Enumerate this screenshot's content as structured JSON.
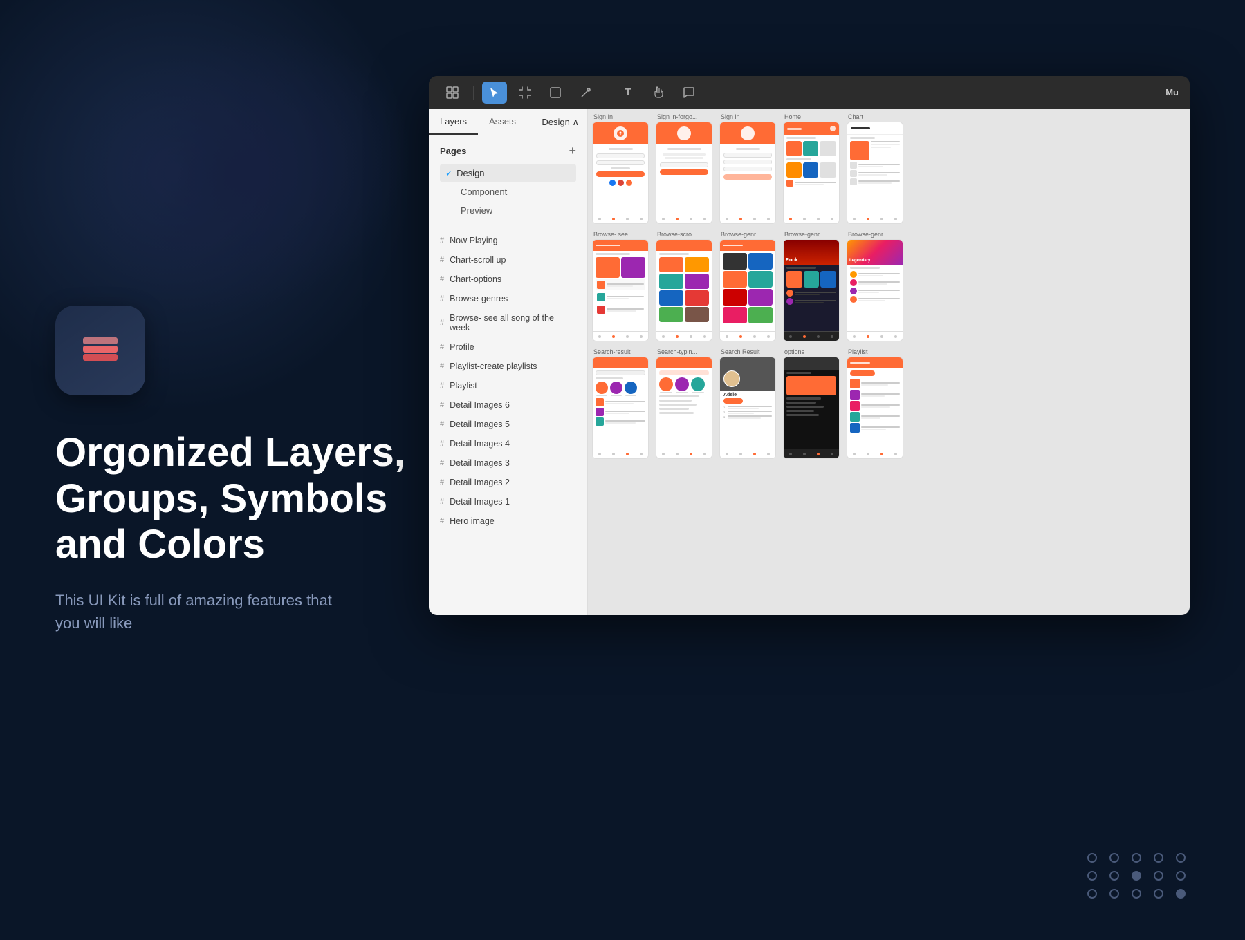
{
  "background": {
    "color": "#0a1628"
  },
  "left_panel": {
    "app_icon_alt": "Layers App Icon",
    "headline": "Orgonized Layers, Groups, Symbols and Colors",
    "subtext": "This UI Kit is full of amazing features that you will like"
  },
  "design_tool": {
    "title": "Mu",
    "toolbar": {
      "tools": [
        {
          "name": "grid-tool",
          "icon": "⊞",
          "active": false
        },
        {
          "name": "select-tool",
          "icon": "▶",
          "active": true
        },
        {
          "name": "frame-tool",
          "icon": "⊡",
          "active": false
        },
        {
          "name": "shape-tool",
          "icon": "□",
          "active": false
        },
        {
          "name": "pen-tool",
          "icon": "✒",
          "active": false
        },
        {
          "name": "text-tool",
          "icon": "T",
          "active": false
        },
        {
          "name": "hand-tool",
          "icon": "✋",
          "active": false
        },
        {
          "name": "comment-tool",
          "icon": "💬",
          "active": false
        }
      ]
    },
    "sidebar": {
      "tabs": [
        "Layers",
        "Assets"
      ],
      "active_tab": "Layers",
      "design_btn": "Design ∧",
      "pages_section": {
        "title": "Pages",
        "pages": [
          {
            "name": "Design",
            "active": true,
            "checked": true
          },
          {
            "name": "Component",
            "active": false
          },
          {
            "name": "Preview",
            "active": false
          }
        ]
      },
      "layers": [
        "Now Playing",
        "Chart-scroll up",
        "Chart-options",
        "Browse-genres",
        "Browse- see all song of the week",
        "Profile",
        "Playlist-create playlists",
        "Playlist",
        "Detail Images 6",
        "Detail Images 5",
        "Detail Images 4",
        "Detail Images 3",
        "Detail Images 2",
        "Detail Images 1",
        "Hero image"
      ]
    },
    "canvas": {
      "rows": [
        {
          "screens": [
            {
              "label": "Sign In",
              "type": "signin"
            },
            {
              "label": "Sign in-forgo...",
              "type": "forgot"
            },
            {
              "label": "Sign in",
              "type": "signup"
            },
            {
              "label": "Home",
              "type": "home"
            },
            {
              "label": "Chart",
              "type": "chart"
            }
          ]
        },
        {
          "screens": [
            {
              "label": "Browse- see...",
              "type": "browse-week"
            },
            {
              "label": "Browse-scro...",
              "type": "browse-scroll"
            },
            {
              "label": "Browse-genr...",
              "type": "browse-genres"
            },
            {
              "label": "Browse-genr...",
              "type": "browse-rock"
            },
            {
              "label": "Browse-genr...",
              "type": "browse-legendary"
            }
          ]
        },
        {
          "screens": [
            {
              "label": "Search-result",
              "type": "search-result"
            },
            {
              "label": "Search-typin...",
              "type": "search-typing"
            },
            {
              "label": "Search Result",
              "type": "search-result2"
            },
            {
              "label": "options",
              "type": "options-dark"
            },
            {
              "label": "Playlist",
              "type": "playlist-list"
            }
          ]
        }
      ]
    }
  },
  "dots_pagination": {
    "rows": [
      [
        false,
        false,
        false,
        false,
        false
      ],
      [
        false,
        false,
        true,
        false,
        false
      ],
      [
        false,
        false,
        false,
        false,
        true
      ]
    ]
  }
}
